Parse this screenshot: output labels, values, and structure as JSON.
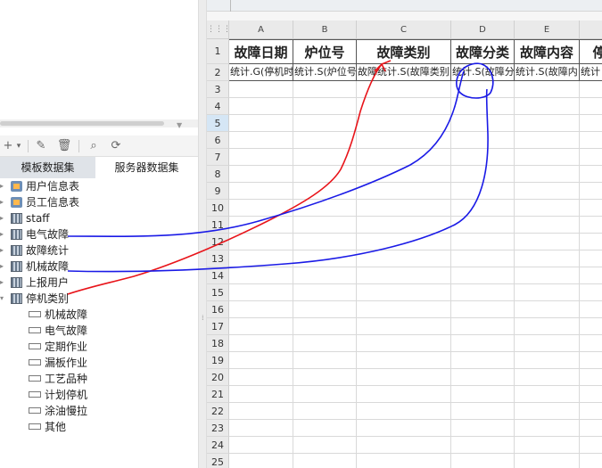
{
  "left_panel": {
    "toolbar": [
      {
        "icon": "add-icon",
        "glyph": "+"
      },
      {
        "icon": "dropdown-icon",
        "glyph": "▾"
      },
      {
        "icon": "edit-icon",
        "glyph": "✎"
      },
      {
        "icon": "delete-icon",
        "glyph": "🗑"
      },
      {
        "icon": "preview-icon",
        "glyph": "⌕"
      },
      {
        "icon": "refresh-icon",
        "glyph": "⟳"
      }
    ],
    "tabs": {
      "template_dataset": "模板数据集",
      "server_dataset": "服务器数据集"
    },
    "tree": [
      {
        "label": "用户信息表",
        "icon": "db"
      },
      {
        "label": "员工信息表",
        "icon": "db"
      },
      {
        "label": "staff",
        "icon": "grid"
      },
      {
        "label": "电气故障",
        "icon": "grid"
      },
      {
        "label": "故障统计",
        "icon": "grid"
      },
      {
        "label": "机械故障",
        "icon": "grid"
      },
      {
        "label": "上报用户",
        "icon": "grid"
      },
      {
        "label": "停机类别",
        "icon": "grid",
        "expanded": true
      },
      {
        "label": "机械故障",
        "icon": "field"
      },
      {
        "label": "电气故障",
        "icon": "field"
      },
      {
        "label": "定期作业",
        "icon": "field"
      },
      {
        "label": "漏板作业",
        "icon": "field"
      },
      {
        "label": "工艺品种",
        "icon": "field"
      },
      {
        "label": "计划停机",
        "icon": "field"
      },
      {
        "label": "涂油慢拉",
        "icon": "field"
      },
      {
        "label": "其他",
        "icon": "field"
      }
    ]
  },
  "sheet": {
    "columns": [
      "A",
      "B",
      "C",
      "D",
      "E"
    ],
    "rows": [
      "1",
      "2",
      "3",
      "4",
      "5",
      "6",
      "7",
      "8",
      "9",
      "10",
      "11",
      "12",
      "13",
      "14",
      "15",
      "16",
      "17",
      "18",
      "19",
      "20",
      "21",
      "22",
      "23",
      "24",
      "25"
    ],
    "selected_row": "5",
    "row1": [
      "故障日期",
      "炉位号",
      "故障类别",
      "故障分类",
      "故障内容",
      "停车"
    ],
    "row2": [
      "统计.G(停机时",
      "统计.S(炉位号",
      "故障统计.S(故障类别",
      "统计.S(故障分",
      "统计.S(故障内",
      "统计"
    ]
  },
  "annotations": {
    "red_color": "#e8141a",
    "blue_color": "#1a1ae6"
  }
}
